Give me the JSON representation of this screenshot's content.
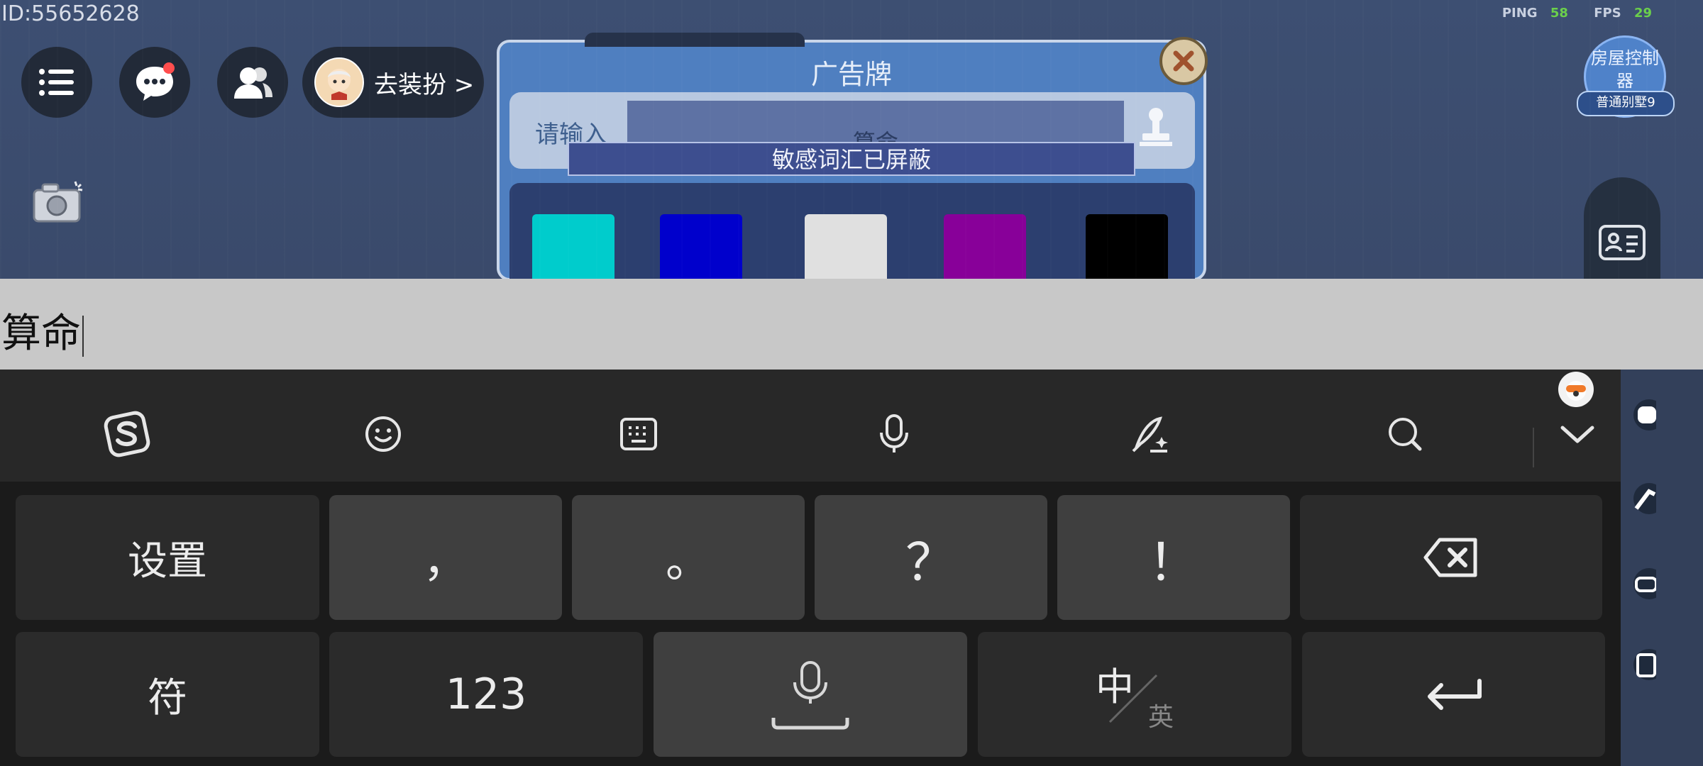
{
  "game": {
    "id_label": "ID:55652628",
    "ping_label": "PING",
    "ping_value": "58",
    "fps_label": "FPS",
    "fps_value": "29",
    "dress_button": "去装扮 >",
    "house_controller": "房屋控制器",
    "house_tag": "普通别墅9"
  },
  "dialog": {
    "title": "广告牌",
    "input_label": "请输入",
    "input_value": "算命",
    "toast": "敏感词汇已屏蔽",
    "palette_colors": [
      "#00cccc",
      "#0000cc",
      "#e0e0e0",
      "#880099",
      "#000000"
    ]
  },
  "ime": {
    "preview_text": "算命",
    "toolbar_icons": [
      "sogou-logo-icon",
      "emoji-icon",
      "keyboard-layout-icon",
      "voice-icon",
      "handwriting-icon",
      "search-icon",
      "collapse-icon"
    ],
    "row1": {
      "settings": "设置",
      "comma": "，",
      "period": "。",
      "question": "？",
      "exclaim": "！"
    },
    "row2": {
      "symbols": "符",
      "numbers": "123",
      "zh": "中",
      "en": "英"
    }
  },
  "colors": {
    "keyboard_bg": "#1b1b1b",
    "key_dark": "#2b2b2b",
    "key_light": "#3f3f3f",
    "dialog_blue": "#4f7fc0",
    "ping_green": "#6bd04b"
  }
}
